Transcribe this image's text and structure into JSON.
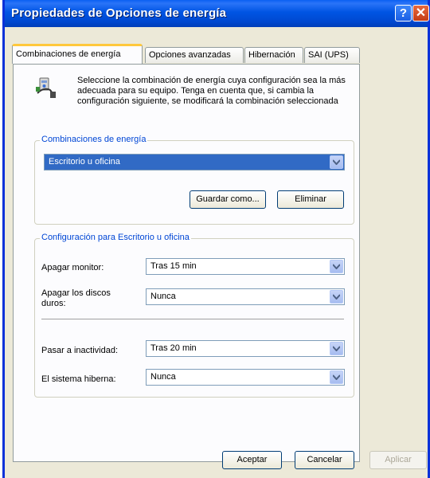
{
  "window": {
    "title": "Propiedades de Opciones de energía"
  },
  "tabs": [
    {
      "label": "Combinaciones de energía"
    },
    {
      "label": "Opciones avanzadas"
    },
    {
      "label": "Hibernación"
    },
    {
      "label": "SAI (UPS)"
    }
  ],
  "intro": {
    "text": "Seleccione la combinación de energía cuya configuración sea la más adecuada para su equipo. Tenga en cuenta que, si cambia la configuración siguiente, se modificará la combinación seleccionada"
  },
  "schemes": {
    "legend": "Combinaciones de energía",
    "selected": "Escritorio u oficina",
    "save_as_label": "Guardar como...",
    "delete_label": "Eliminar"
  },
  "settings": {
    "legend": "Configuración para Escritorio u oficina",
    "monitor_label": "Apagar monitor:",
    "monitor_value": "Tras 15 min",
    "disks_label": "Apagar los discos duros:",
    "disks_value": "Nunca",
    "standby_label": "Pasar a inactividad:",
    "standby_value": "Tras 20 min",
    "hibernate_label": "El sistema hiberna:",
    "hibernate_value": "Nunca"
  },
  "footer": {
    "ok_label": "Aceptar",
    "cancel_label": "Cancelar",
    "apply_label": "Aplicar"
  },
  "colors": {
    "titlebar": "#0054e3",
    "selection": "#316ac5",
    "group_legend": "#0046d5",
    "tab_highlight": "#ffc83c"
  }
}
